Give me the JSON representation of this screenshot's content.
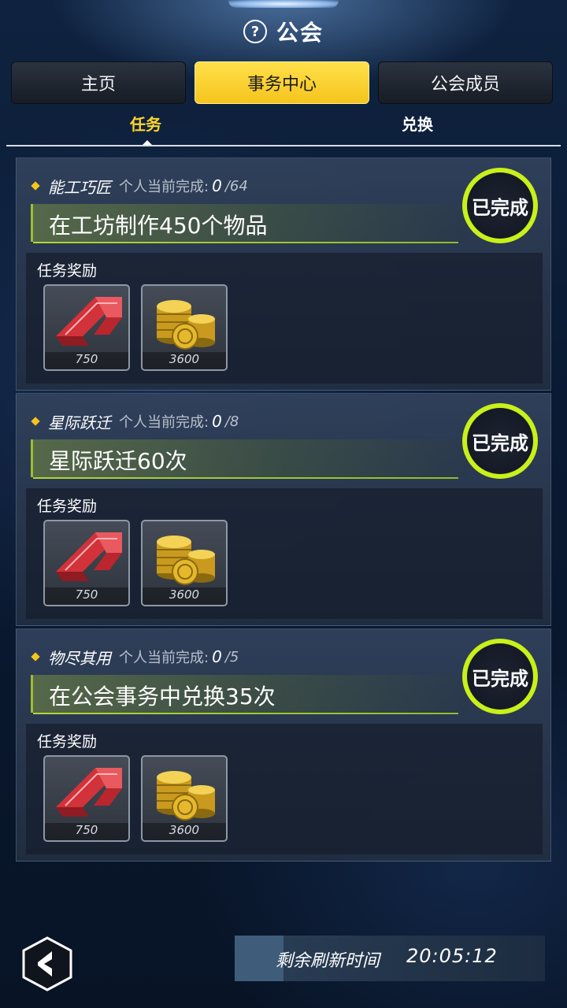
{
  "header": {
    "title": "公会",
    "help_glyph": "?"
  },
  "tabs": [
    {
      "label": "主页"
    },
    {
      "label": "事务中心"
    },
    {
      "label": "公会成员"
    }
  ],
  "subtabs": [
    {
      "label": "任务"
    },
    {
      "label": "兑换"
    }
  ],
  "tasks": [
    {
      "name": "能工巧匠",
      "progress_label": "个人当前完成:",
      "progress_current": "0",
      "progress_total": "/64",
      "goal": "在工坊制作450个物品",
      "status": "已完成",
      "reward_label": "任务奖励",
      "rewards": [
        {
          "icon": "red-chevron-icon",
          "count": "750"
        },
        {
          "icon": "gold-coins-icon",
          "count": "3600"
        }
      ]
    },
    {
      "name": "星际跃迁",
      "progress_label": "个人当前完成:",
      "progress_current": "0",
      "progress_total": "/8",
      "goal": "星际跃迁60次",
      "status": "已完成",
      "reward_label": "任务奖励",
      "rewards": [
        {
          "icon": "red-chevron-icon",
          "count": "750"
        },
        {
          "icon": "gold-coins-icon",
          "count": "3600"
        }
      ]
    },
    {
      "name": "物尽其用",
      "progress_label": "个人当前完成:",
      "progress_current": "0",
      "progress_total": "/5",
      "goal": "在公会事务中兑换35次",
      "status": "已完成",
      "reward_label": "任务奖励",
      "rewards": [
        {
          "icon": "red-chevron-icon",
          "count": "750"
        },
        {
          "icon": "gold-coins-icon",
          "count": "3600"
        }
      ]
    }
  ],
  "footer": {
    "back_icon": "back-arrow-icon",
    "refresh_label": "剩余刷新时间",
    "refresh_time": "20:05:12"
  },
  "colors": {
    "accent_yellow": "#f5c41d",
    "done_green": "#c8f01a",
    "subtab_active": "#ffd52a"
  }
}
